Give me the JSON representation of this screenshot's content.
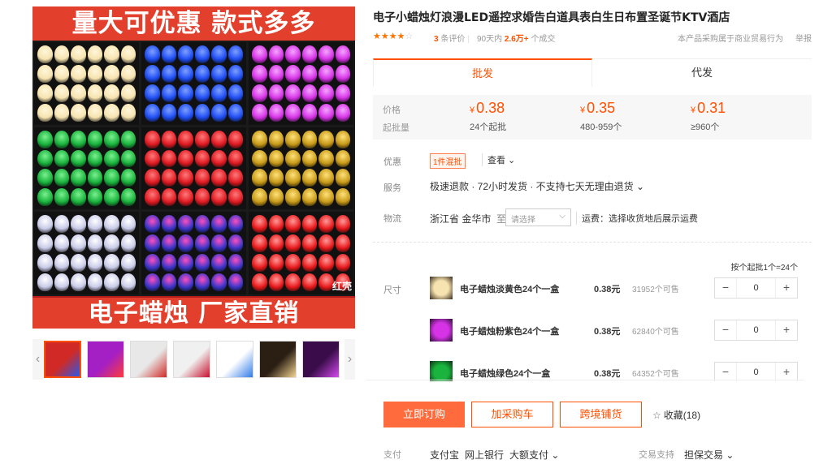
{
  "gallery": {
    "banner_top": "量大可优惠  款式多多",
    "banner_bottom": "电子蜡烛  厂家直销",
    "cell_tag": "红壳",
    "cells": [
      {
        "color": "#f6e3b0",
        "glow": "#fff6da"
      },
      {
        "color": "#1f4df2",
        "glow": "#7fa0ff"
      },
      {
        "color": "#d633e6",
        "glow": "#f5a6ff"
      },
      {
        "color": "#19b33d",
        "glow": "#7cf08f"
      },
      {
        "color": "#e01a22",
        "glow": "#ff7a7a"
      },
      {
        "color": "#c89a18",
        "glow": "#ffe27a"
      },
      {
        "color": "#c9cbe8",
        "glow": "#ffffff"
      },
      {
        "color": "#3a36c9",
        "glow": "#ff4fbf"
      },
      {
        "color": "#e8191b",
        "glow": "#ff9a9a"
      }
    ],
    "thumbs": [
      {
        "color": "#d12a26",
        "accent": "#2a58e8"
      },
      {
        "color": "#a41fc4",
        "accent": "#ff3a3a"
      },
      {
        "color": "#e8e8e8",
        "accent": "#d12a26"
      },
      {
        "color": "#f0f0f0",
        "accent": "#c8102e"
      },
      {
        "color": "#ffffff",
        "accent": "#2f7bea"
      },
      {
        "color": "#2b1f14",
        "accent": "#f4d491"
      },
      {
        "color": "#3a0d4a",
        "accent": "#d64af0"
      }
    ],
    "arrow_left": "‹",
    "arrow_right": "›"
  },
  "product": {
    "title": "电子小蜡烛灯浪漫LED遥控求婚告白道具表白生日布置圣诞节KTV酒店",
    "rating_stars": 4,
    "reviews_count": "3",
    "reviews_label": "条评价",
    "sold_period": "90天内",
    "sold_count": "2.6万+",
    "sold_unit": "个成交",
    "notice": "本产品采购属于商业贸易行为",
    "report": "举报"
  },
  "tabs": [
    "批发",
    "代发"
  ],
  "pricing": {
    "price_label": "价格",
    "moq_label": "起批量",
    "currency": "¥",
    "tiers": [
      {
        "price": "0.38",
        "range": "24个起批"
      },
      {
        "price": "0.35",
        "range": "480-959个"
      },
      {
        "price": "0.31",
        "range": "≥960个"
      }
    ]
  },
  "promo": {
    "label": "优惠",
    "tag": "1件混批",
    "view": "查看 ⌄"
  },
  "service": {
    "label": "服务",
    "text": "极速退款 · 72小时发货 · 不支持七天无理由退货 ⌄"
  },
  "logistics": {
    "label": "物流",
    "origin": "浙江省 金华市",
    "to": "至",
    "select_placeholder": "请选择",
    "freight": "运费：选择收货地后展示运费"
  },
  "sku": {
    "label": "尺寸",
    "batch_note": "按个起批1个=24个",
    "items": [
      {
        "name": "电子蜡烛淡黄色24个一盒",
        "price": "0.38元",
        "stock": "31952个可售",
        "qty": "0",
        "color": "#f6e3b0",
        "bg": "#3a2a1a"
      },
      {
        "name": "电子蜡烛粉紫色24个一盒",
        "price": "0.38元",
        "stock": "62840个可售",
        "qty": "0",
        "color": "#d633e6",
        "bg": "#2a0f33"
      },
      {
        "name": "电子蜡烛绿色24个一盒",
        "price": "0.38元",
        "stock": "64352个可售",
        "qty": "0",
        "color": "#19b33d",
        "bg": "#0f2a14"
      }
    ],
    "minus": "−",
    "plus": "+"
  },
  "actions": {
    "buy": "立即订购",
    "cart": "加采购车",
    "cross": "跨境铺货",
    "fav": "收藏(18)"
  },
  "payment": {
    "label": "支付",
    "options": [
      "支付宝",
      "网上银行",
      "大额支付 ⌄"
    ],
    "trade_label": "交易支持",
    "trade_option": "担保交易 ⌄"
  }
}
